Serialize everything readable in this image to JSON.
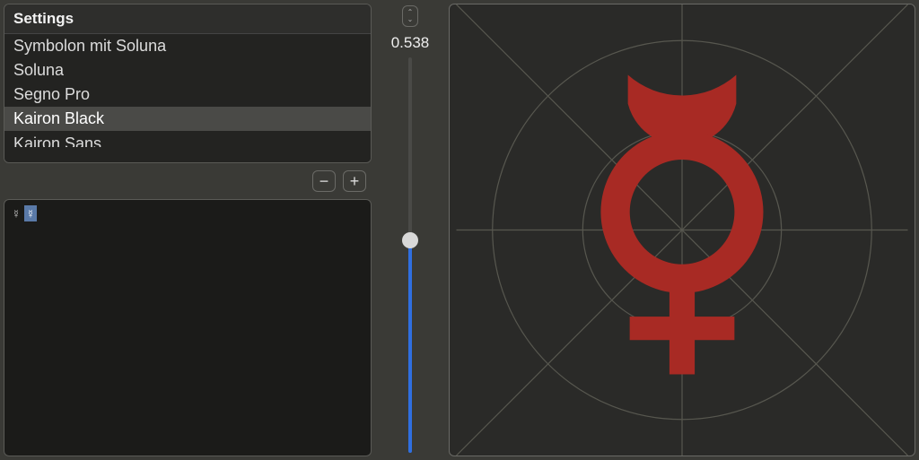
{
  "settings": {
    "title": "Settings",
    "items": [
      {
        "label": "Symbolon mit Soluna",
        "selected": false
      },
      {
        "label": "Soluna",
        "selected": false
      },
      {
        "label": "Segno Pro",
        "selected": false
      },
      {
        "label": "Kairon Black",
        "selected": true
      },
      {
        "label": "Kairon Sans",
        "selected": false
      }
    ]
  },
  "buttons": {
    "minus": "−",
    "plus": "+"
  },
  "glyphs": [
    {
      "char": "☿",
      "selected": false
    },
    {
      "char": "☿",
      "selected": true
    }
  ],
  "slider": {
    "value": "0.538",
    "fraction": 0.538
  },
  "preview": {
    "glyph_color": "#a82a24",
    "guide_color": "#57574f",
    "symbol": "mercury"
  }
}
